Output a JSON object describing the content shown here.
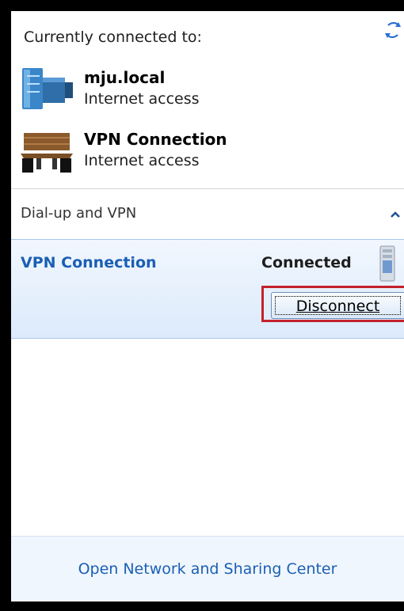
{
  "header": {
    "title": "Currently connected to:"
  },
  "connections": [
    {
      "name": "mju.local",
      "status": "Internet access",
      "icon": "network-icon"
    },
    {
      "name": "VPN Connection",
      "status": "Internet access",
      "icon": "bench-icon"
    }
  ],
  "section": {
    "title": "Dial-up and VPN"
  },
  "vpn": {
    "name": "VPN Connection",
    "status": "Connected",
    "button_label": "Disconnect",
    "highlight_color": "#c4212b"
  },
  "footer": {
    "link_text": "Open Network and Sharing Center"
  }
}
